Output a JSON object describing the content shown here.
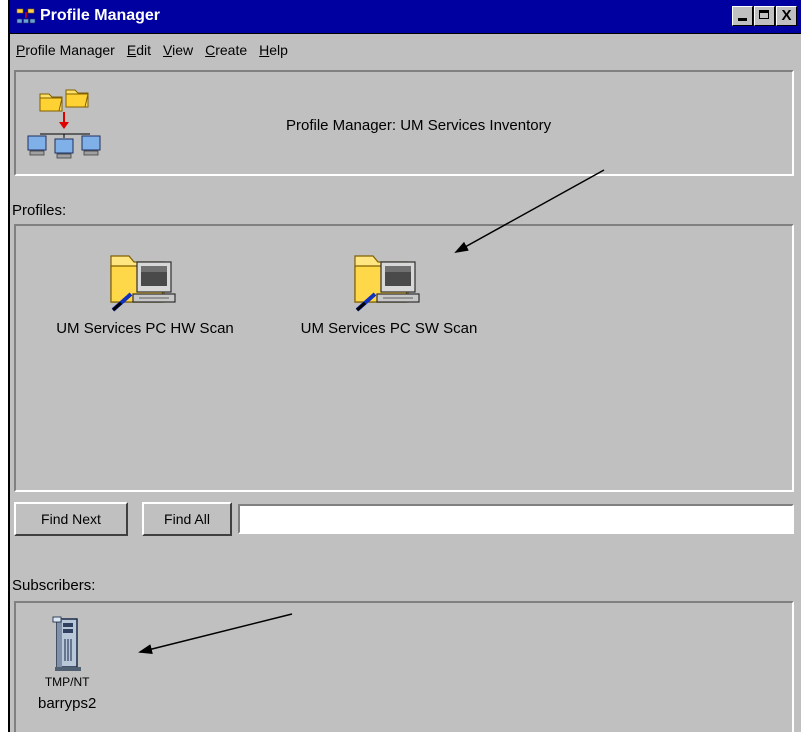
{
  "window": {
    "title": "Profile Manager"
  },
  "menu": [
    "Profile Manager",
    "Edit",
    "View",
    "Create",
    "Help"
  ],
  "menu_mnemonics": [
    "P",
    "E",
    "V",
    "C",
    "H"
  ],
  "header": {
    "title": "Profile Manager:  UM Services Inventory"
  },
  "profiles": {
    "label": "Profiles:",
    "items": [
      {
        "label": "UM Services PC HW Scan",
        "icon": "profile-folder-computer-icon"
      },
      {
        "label": "UM Services PC SW Scan",
        "icon": "profile-folder-computer-icon"
      }
    ]
  },
  "find": {
    "next_label": "Find Next",
    "all_label": "Find All",
    "value": ""
  },
  "subscribers": {
    "label": "Subscribers:",
    "items": [
      {
        "tag": "TMP/NT",
        "name": "barryps2",
        "icon": "server-tower-icon"
      }
    ]
  },
  "colors": {
    "titlebar": "#0000a0",
    "face": "#c0c0c0",
    "arrow": "#000000"
  }
}
